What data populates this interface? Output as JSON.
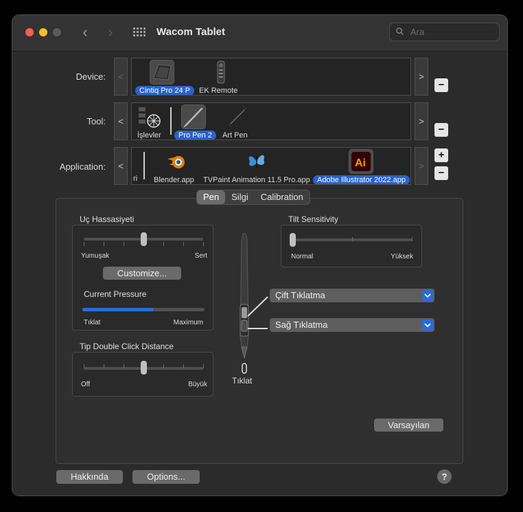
{
  "window": {
    "title": "Wacom Tablet"
  },
  "search": {
    "placeholder": "Ara"
  },
  "device": {
    "label": "Device:",
    "items": [
      {
        "label": "Cintiq Pro 24 P",
        "selected": true
      },
      {
        "label": "EK Remote",
        "selected": false
      }
    ],
    "prev": "<",
    "next": ">",
    "remove": "−"
  },
  "tool": {
    "label": "Tool:",
    "items": [
      {
        "label": "İşlevler",
        "selected": false
      },
      {
        "label": "Pro Pen 2",
        "selected": true
      },
      {
        "label": "Art Pen",
        "selected": false
      }
    ],
    "prev": "<",
    "next": ">",
    "remove": "−"
  },
  "application": {
    "label": "Application:",
    "items": [
      {
        "label": "Blender.app",
        "selected": false
      },
      {
        "label": "TVPaint Animation 11.5 Pro.app",
        "selected": false
      },
      {
        "label": "Adobe Illustrator 2022.app",
        "selected": true
      }
    ],
    "truncated_left": "ri",
    "prev": "<",
    "next": ">",
    "add": "+",
    "remove": "−"
  },
  "tabs": [
    {
      "label": "Pen",
      "active": true
    },
    {
      "label": "Silgi",
      "active": false
    },
    {
      "label": "Calibration",
      "active": false
    }
  ],
  "tip_feel": {
    "title": "Uç Hassasiyeti",
    "min_label": "Yumuşak",
    "max_label": "Sert",
    "value_fraction": 0.5,
    "customize_label": "Customize...",
    "pressure_title": "Current Pressure",
    "pressure_min": "Tıklat",
    "pressure_max": "Maximum",
    "pressure_fraction": 0.58
  },
  "double_click": {
    "title": "Tip Double Click Distance",
    "min_label": "Off",
    "max_label": "Büyük",
    "value_fraction": 0.5
  },
  "tilt": {
    "title": "Tilt Sensitivity",
    "min_label": "Normal",
    "max_label": "Yüksek",
    "value_fraction": 0.0
  },
  "pen_buttons": {
    "upper": "Çift Tıklatma",
    "lower": "Sağ Tıklatma",
    "tip": "Tıklat"
  },
  "buttons": {
    "default": "Varsayılan",
    "about": "Hakkında",
    "options": "Options...",
    "help": "?"
  },
  "colors": {
    "accent": "#2a6bdc",
    "selection": "#2a62c9",
    "window_bg": "#2b2b2b"
  }
}
